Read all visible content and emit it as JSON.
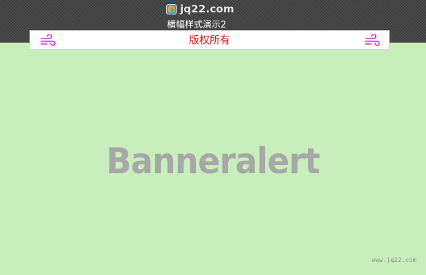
{
  "brand": {
    "name": "jq22.com",
    "logo_icon": "jq22-logo-icon"
  },
  "demo_title": "横幅样式演示2",
  "banner": {
    "text": "版权所有",
    "left_icon": "wind-icon",
    "right_icon": "wind-icon",
    "text_color": "#d31818",
    "icon_color": "#e020e0"
  },
  "hero": {
    "text": "Banneralert",
    "color": "#a7a7a7"
  },
  "watermark": "www.jq22.com",
  "colors": {
    "page_background": "#c7eebb",
    "topbar_background": "#464646"
  }
}
